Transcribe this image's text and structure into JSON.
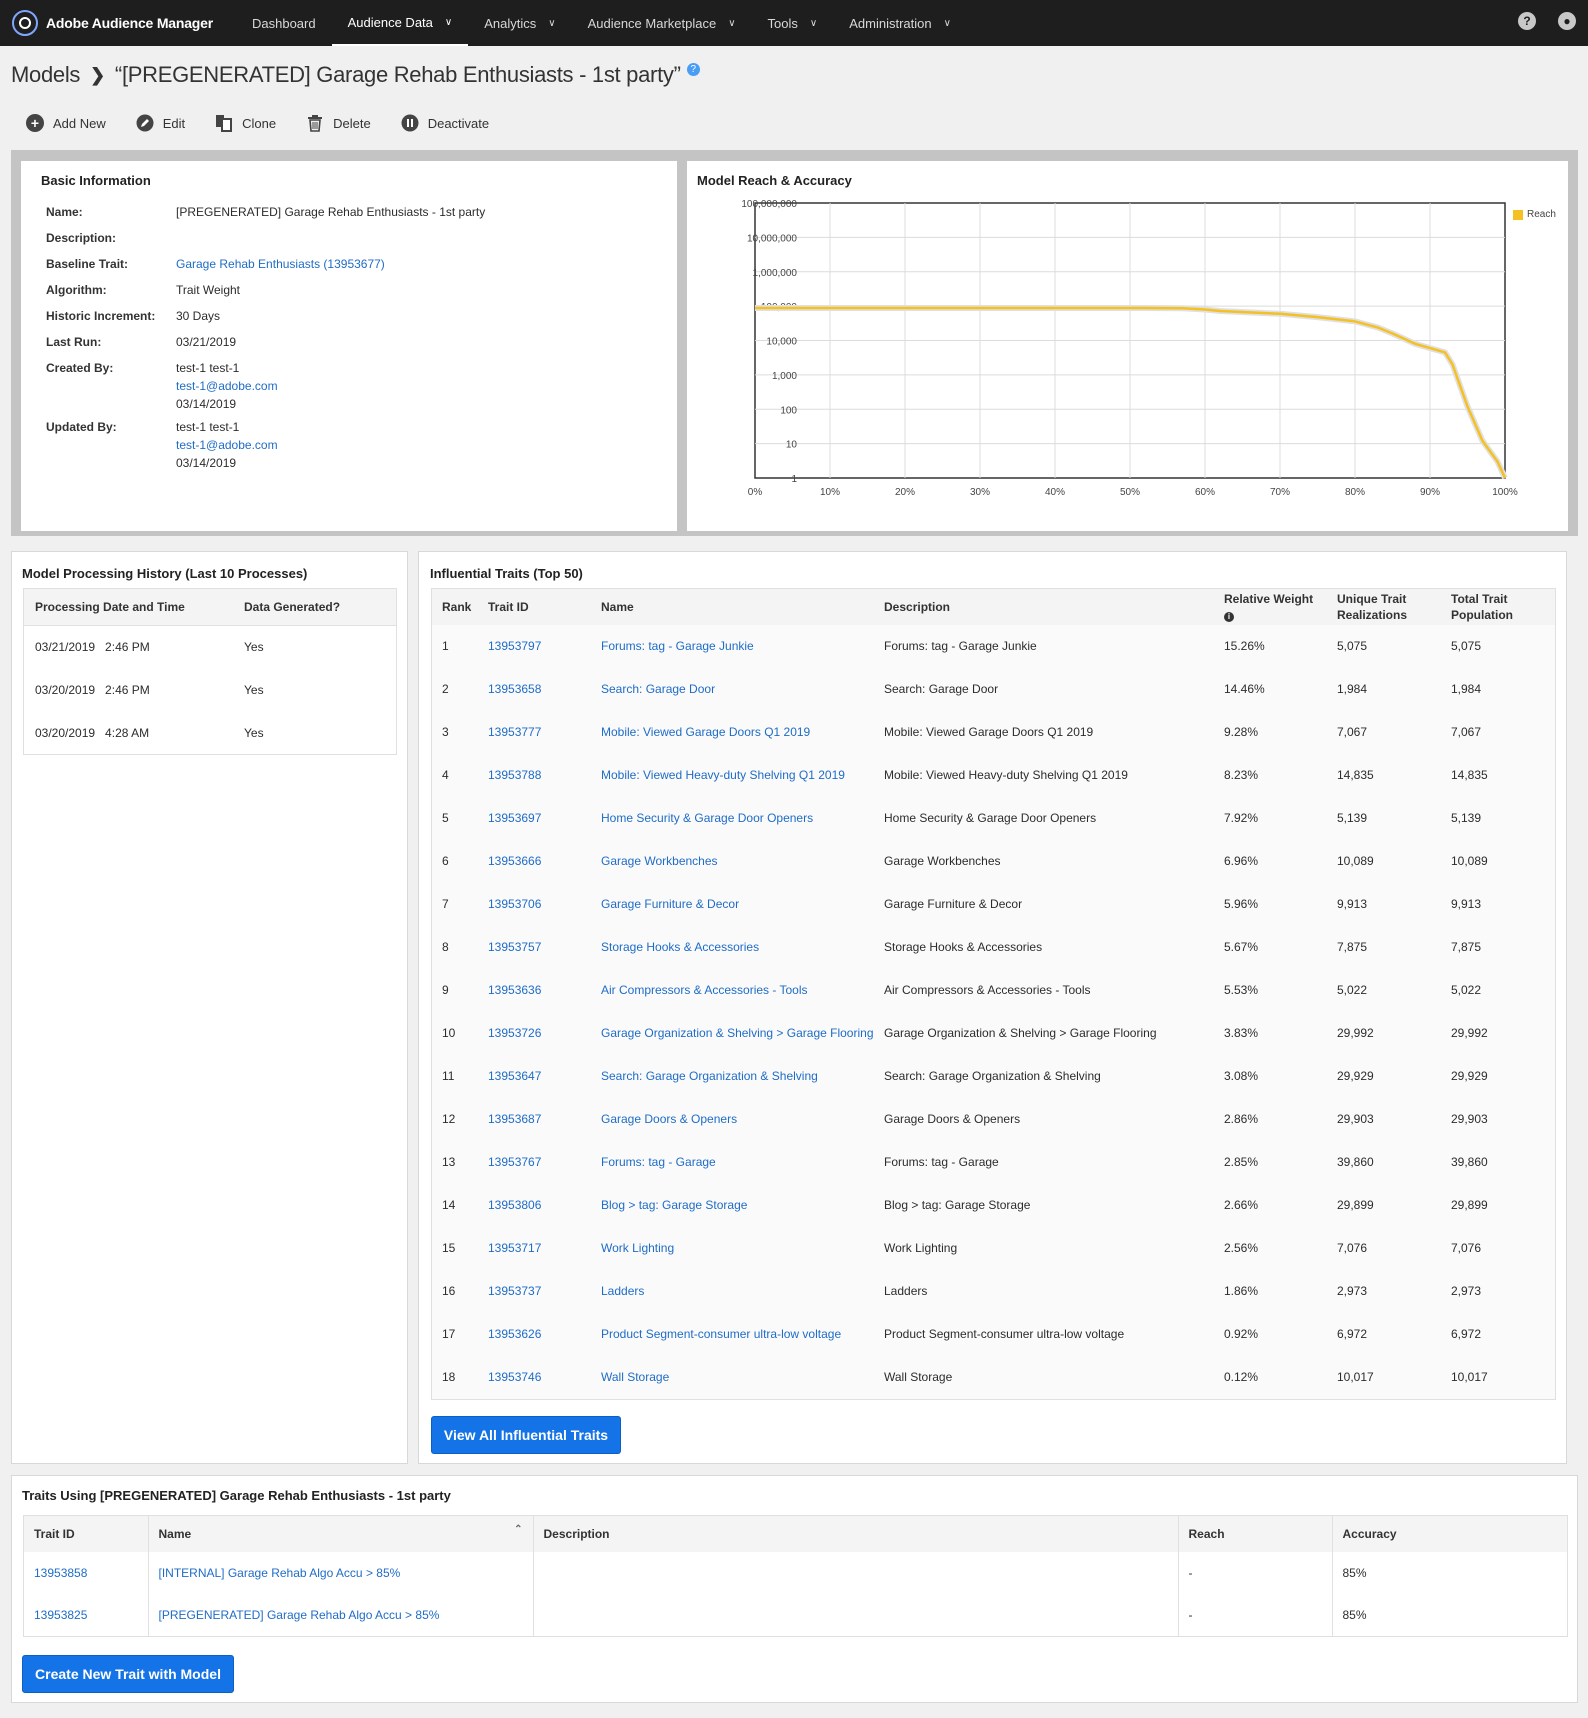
{
  "app": {
    "name": "Adobe Audience Manager"
  },
  "nav": [
    {
      "label": "Dashboard",
      "dropdown": false
    },
    {
      "label": "Audience Data",
      "dropdown": true,
      "active": true
    },
    {
      "label": "Analytics",
      "dropdown": true
    },
    {
      "label": "Audience Marketplace",
      "dropdown": true
    },
    {
      "label": "Tools",
      "dropdown": true
    },
    {
      "label": "Administration",
      "dropdown": true
    }
  ],
  "breadcrumb": {
    "root": "Models",
    "current": "“[PREGENERATED] Garage Rehab Enthusiasts - 1st party”"
  },
  "toolbar": {
    "add_new": "Add New",
    "edit": "Edit",
    "clone": "Clone",
    "delete": "Delete",
    "deactivate": "Deactivate"
  },
  "basic_info": {
    "title": "Basic Information",
    "rows": [
      {
        "label": "Name:",
        "lines": [
          "[PREGENERATED] Garage Rehab Enthusiasts - 1st party"
        ]
      },
      {
        "label": "Description:",
        "lines": []
      },
      {
        "label": "Baseline Trait:",
        "lines": [
          "Garage Rehab Enthusiasts (13953677)"
        ],
        "link": [
          true
        ]
      },
      {
        "label": "Algorithm:",
        "lines": [
          "Trait Weight"
        ]
      },
      {
        "label": "Historic Increment:",
        "lines": [
          "30 Days"
        ]
      },
      {
        "label": "Last Run:",
        "lines": [
          "03/21/2019"
        ]
      },
      {
        "label": "Created By:",
        "lines": [
          "test-1 test-1",
          "test-1@adobe.com",
          "03/14/2019"
        ],
        "link": [
          false,
          true,
          false
        ]
      },
      {
        "label": "Updated By:",
        "lines": [
          "test-1 test-1",
          "test-1@adobe.com",
          "03/14/2019"
        ],
        "link": [
          false,
          true,
          false
        ]
      }
    ]
  },
  "reach_panel": {
    "title": "Model Reach & Accuracy"
  },
  "chart_data": {
    "type": "line",
    "title": "Model Reach & Accuracy",
    "x_scale": "linear",
    "y_scale": "log",
    "x_ticks": [
      "0%",
      "10%",
      "20%",
      "30%",
      "40%",
      "50%",
      "60%",
      "70%",
      "80%",
      "90%",
      "100%"
    ],
    "y_ticks": [
      "1",
      "10",
      "100",
      "1,000",
      "10,000",
      "100,000",
      "1,000,000",
      "10,000,000",
      "100,000,000"
    ],
    "xlim": [
      0,
      100
    ],
    "ylim": [
      1,
      100000000
    ],
    "grid": true,
    "legend": "top-right",
    "series": [
      {
        "name": "Reach",
        "color": "#f5c022",
        "x": [
          0,
          10,
          20,
          30,
          40,
          50,
          57,
          60,
          62,
          70,
          75,
          80,
          83,
          85,
          88,
          90,
          92,
          93,
          95,
          97,
          99,
          100
        ],
        "y": [
          88000,
          88000,
          88000,
          88000,
          88000,
          88000,
          87000,
          80000,
          72000,
          60000,
          48000,
          36000,
          24000,
          16000,
          8000,
          6000,
          4500,
          2000,
          120,
          12,
          3,
          1
        ]
      }
    ]
  },
  "history": {
    "title": "Model Processing History (Last 10 Processes)",
    "columns": [
      "Processing Date and Time",
      "Data Generated?"
    ],
    "rows": [
      [
        "03/21/2019   2:46 PM",
        "Yes"
      ],
      [
        "03/20/2019   2:46 PM",
        "Yes"
      ],
      [
        "03/20/2019   4:28 AM",
        "Yes"
      ]
    ]
  },
  "influential": {
    "title": "Influential Traits (Top 50)",
    "columns": [
      "Rank",
      "Trait ID",
      "Name",
      "Description",
      "Relative Weight",
      "Unique Trait Realizations",
      "Total Trait Population"
    ],
    "rows": [
      [
        "1",
        "13953797",
        "Forums: tag - Garage Junkie",
        "Forums: tag - Garage Junkie",
        "15.26%",
        "5,075",
        "5,075"
      ],
      [
        "2",
        "13953658",
        "Search: Garage Door",
        "Search: Garage Door",
        "14.46%",
        "1,984",
        "1,984"
      ],
      [
        "3",
        "13953777",
        "Mobile: Viewed Garage Doors Q1 2019",
        "Mobile: Viewed Garage Doors Q1 2019",
        "9.28%",
        "7,067",
        "7,067"
      ],
      [
        "4",
        "13953788",
        "Mobile: Viewed Heavy-duty Shelving Q1 2019",
        "Mobile: Viewed Heavy-duty Shelving Q1 2019",
        "8.23%",
        "14,835",
        "14,835"
      ],
      [
        "5",
        "13953697",
        "Home Security & Garage Door Openers",
        "Home Security & Garage Door Openers",
        "7.92%",
        "5,139",
        "5,139"
      ],
      [
        "6",
        "13953666",
        "Garage Workbenches",
        "Garage Workbenches",
        "6.96%",
        "10,089",
        "10,089"
      ],
      [
        "7",
        "13953706",
        "Garage Furniture & Decor",
        "Garage Furniture & Decor",
        "5.96%",
        "9,913",
        "9,913"
      ],
      [
        "8",
        "13953757",
        "Storage Hooks & Accessories",
        "Storage Hooks & Accessories",
        "5.67%",
        "7,875",
        "7,875"
      ],
      [
        "9",
        "13953636",
        "Air Compressors & Accessories - Tools",
        "Air Compressors & Accessories - Tools",
        "5.53%",
        "5,022",
        "5,022"
      ],
      [
        "10",
        "13953726",
        "Garage Organization & Shelving > Garage Flooring",
        "Garage Organization & Shelving > Garage Flooring",
        "3.83%",
        "29,992",
        "29,992"
      ],
      [
        "11",
        "13953647",
        "Search: Garage Organization & Shelving",
        "Search: Garage Organization & Shelving",
        "3.08%",
        "29,929",
        "29,929"
      ],
      [
        "12",
        "13953687",
        "Garage Doors & Openers",
        "Garage Doors & Openers",
        "2.86%",
        "29,903",
        "29,903"
      ],
      [
        "13",
        "13953767",
        "Forums: tag - Garage",
        "Forums: tag - Garage",
        "2.85%",
        "39,860",
        "39,860"
      ],
      [
        "14",
        "13953806",
        "Blog > tag: Garage Storage",
        "Blog > tag: Garage Storage",
        "2.66%",
        "29,899",
        "29,899"
      ],
      [
        "15",
        "13953717",
        "Work Lighting",
        "Work Lighting",
        "2.56%",
        "7,076",
        "7,076"
      ],
      [
        "16",
        "13953737",
        "Ladders",
        "Ladders",
        "1.86%",
        "2,973",
        "2,973"
      ],
      [
        "17",
        "13953626",
        "Product Segment-consumer ultra-low voltage",
        "Product Segment-consumer ultra-low voltage",
        "0.92%",
        "6,972",
        "6,972"
      ],
      [
        "18",
        "13953746",
        "Wall Storage",
        "Wall Storage",
        "0.12%",
        "10,017",
        "10,017"
      ]
    ],
    "view_all_button": "View All Influential Traits"
  },
  "traits_using": {
    "title": "Traits Using [PREGENERATED] Garage Rehab Enthusiasts - 1st party",
    "columns": [
      "Trait ID",
      "Name",
      "Description",
      "Reach",
      "Accuracy"
    ],
    "rows": [
      [
        "13953858",
        "[INTERNAL] Garage Rehab Algo Accu > 85%",
        "",
        "-",
        "85%"
      ],
      [
        "13953825",
        "[PREGENERATED] Garage Rehab Algo Accu > 85%",
        "",
        "-",
        "85%"
      ]
    ],
    "create_button": "Create New Trait with Model"
  }
}
